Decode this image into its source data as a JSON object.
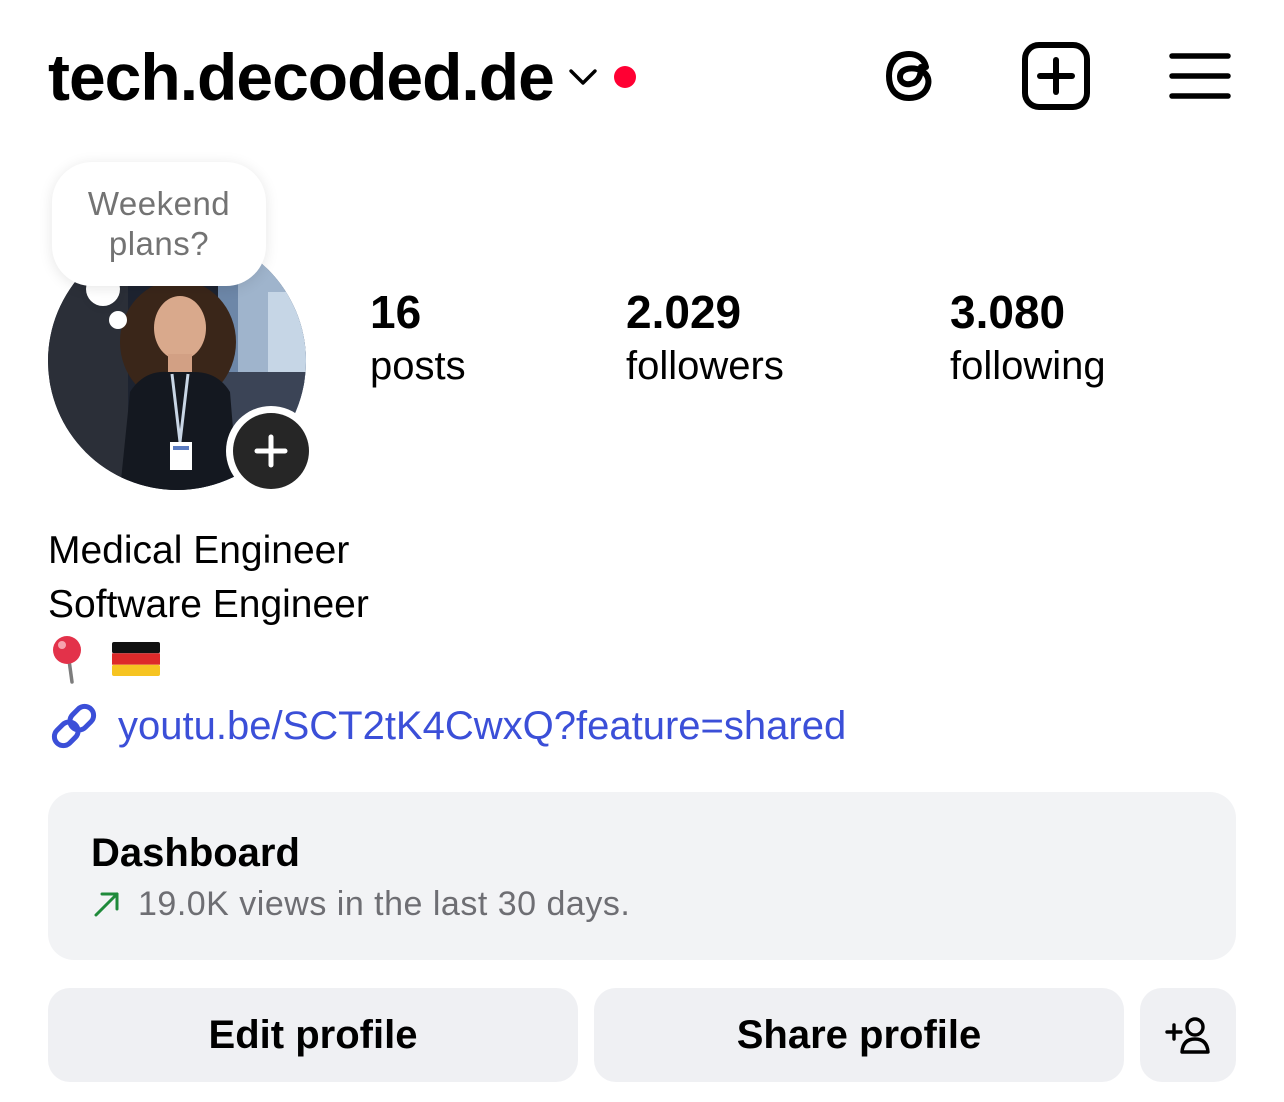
{
  "header": {
    "username": "tech.decoded.de",
    "icons": [
      "chevron-down-icon",
      "threads-icon",
      "plus-square-icon",
      "menu-icon"
    ],
    "notification_dot_color": "#ff0033"
  },
  "note": {
    "text": "Weekend plans?"
  },
  "stats": {
    "posts": {
      "value": "16",
      "label": "posts"
    },
    "followers": {
      "value": "2.029",
      "label": "followers"
    },
    "following": {
      "value": "3.080",
      "label": "following"
    }
  },
  "bio": {
    "lines": [
      "Medical Engineer",
      "Software Engineer"
    ],
    "emojis": [
      "📍",
      "🇩🇪"
    ],
    "link": "youtu.be/SCT2tK4CwxQ?feature=shared"
  },
  "dashboard": {
    "title": "Dashboard",
    "subtitle": "19.0K views in the last 30 days."
  },
  "buttons": {
    "edit": "Edit profile",
    "share": "Share profile"
  },
  "colors": {
    "link": "#3b4fd8",
    "trend_up": "#1f8a3a",
    "button_bg": "#eff0f3",
    "card_bg": "#f2f3f5"
  }
}
